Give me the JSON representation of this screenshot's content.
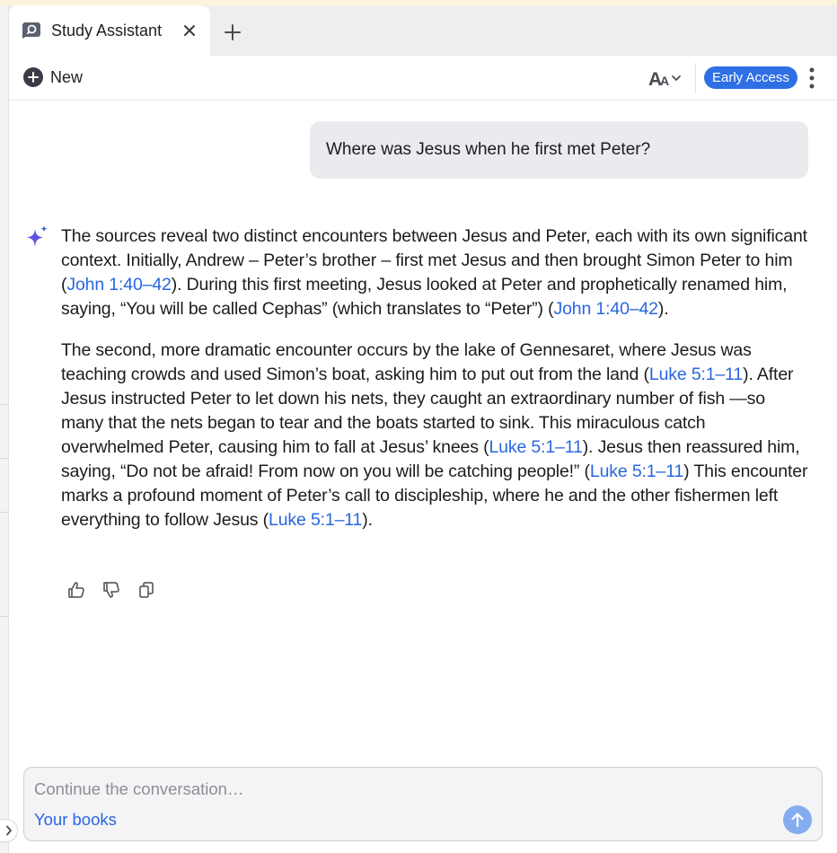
{
  "tab": {
    "title": "Study Assistant",
    "icon": "study-assistant-icon"
  },
  "toolbar": {
    "new_label": "New",
    "new_icon": "plus-circle-icon",
    "font_icon": "font-size-icon",
    "badge": "Early Access",
    "more_icon": "more-vertical-icon"
  },
  "conversation": {
    "question": "Where was Jesus when he first met Peter?",
    "answer": {
      "paragraph1": {
        "t1": "The sources reveal two distinct encounters between Jesus and Peter, each with its own significant context. Initially, Andrew – Peter’s brother – first met Jesus and then brought Simon Peter to him (",
        "ref1": "John 1:40–42",
        "t2": "). During this first meeting, Jesus looked at Peter and prophetically renamed him, saying, “You will be called Cephas” (which translates to “Peter”) (",
        "ref2": "John 1:40–42",
        "t3": ")."
      },
      "paragraph2": {
        "t1": "The second, more dramatic encounter occurs by the lake of Gennesaret, where Jesus was teaching crowds and used Simon’s boat, asking him to put out from the land (",
        "ref1": "Luke 5:1–11",
        "t2": "). After Jesus instructed Peter to let down his nets, they caught an extraordinary number of fish —so many that the nets began to tear and the boats started to sink. This miraculous catch overwhelmed Peter, causing him to fall at Jesus’ knees (",
        "ref2": "Luke 5:1–11",
        "t3": "). Jesus then reassured him, saying, “Do not be afraid! From now on you will be catching people!” (",
        "ref3": "Luke 5:1–11",
        "t4": ") This encounter marks a profound moment of Peter’s call to discipleship, where he and the other fishermen left everything to follow Jesus (",
        "ref4": "Luke 5:1–11",
        "t5": ")."
      }
    }
  },
  "composer": {
    "placeholder": "Continue the conversation…",
    "value": "",
    "books_label": "Your books"
  },
  "colors": {
    "accent": "#2f6fe4",
    "link": "#2966e0",
    "send": "#86acf0",
    "user_bubble": "#ebebef"
  }
}
